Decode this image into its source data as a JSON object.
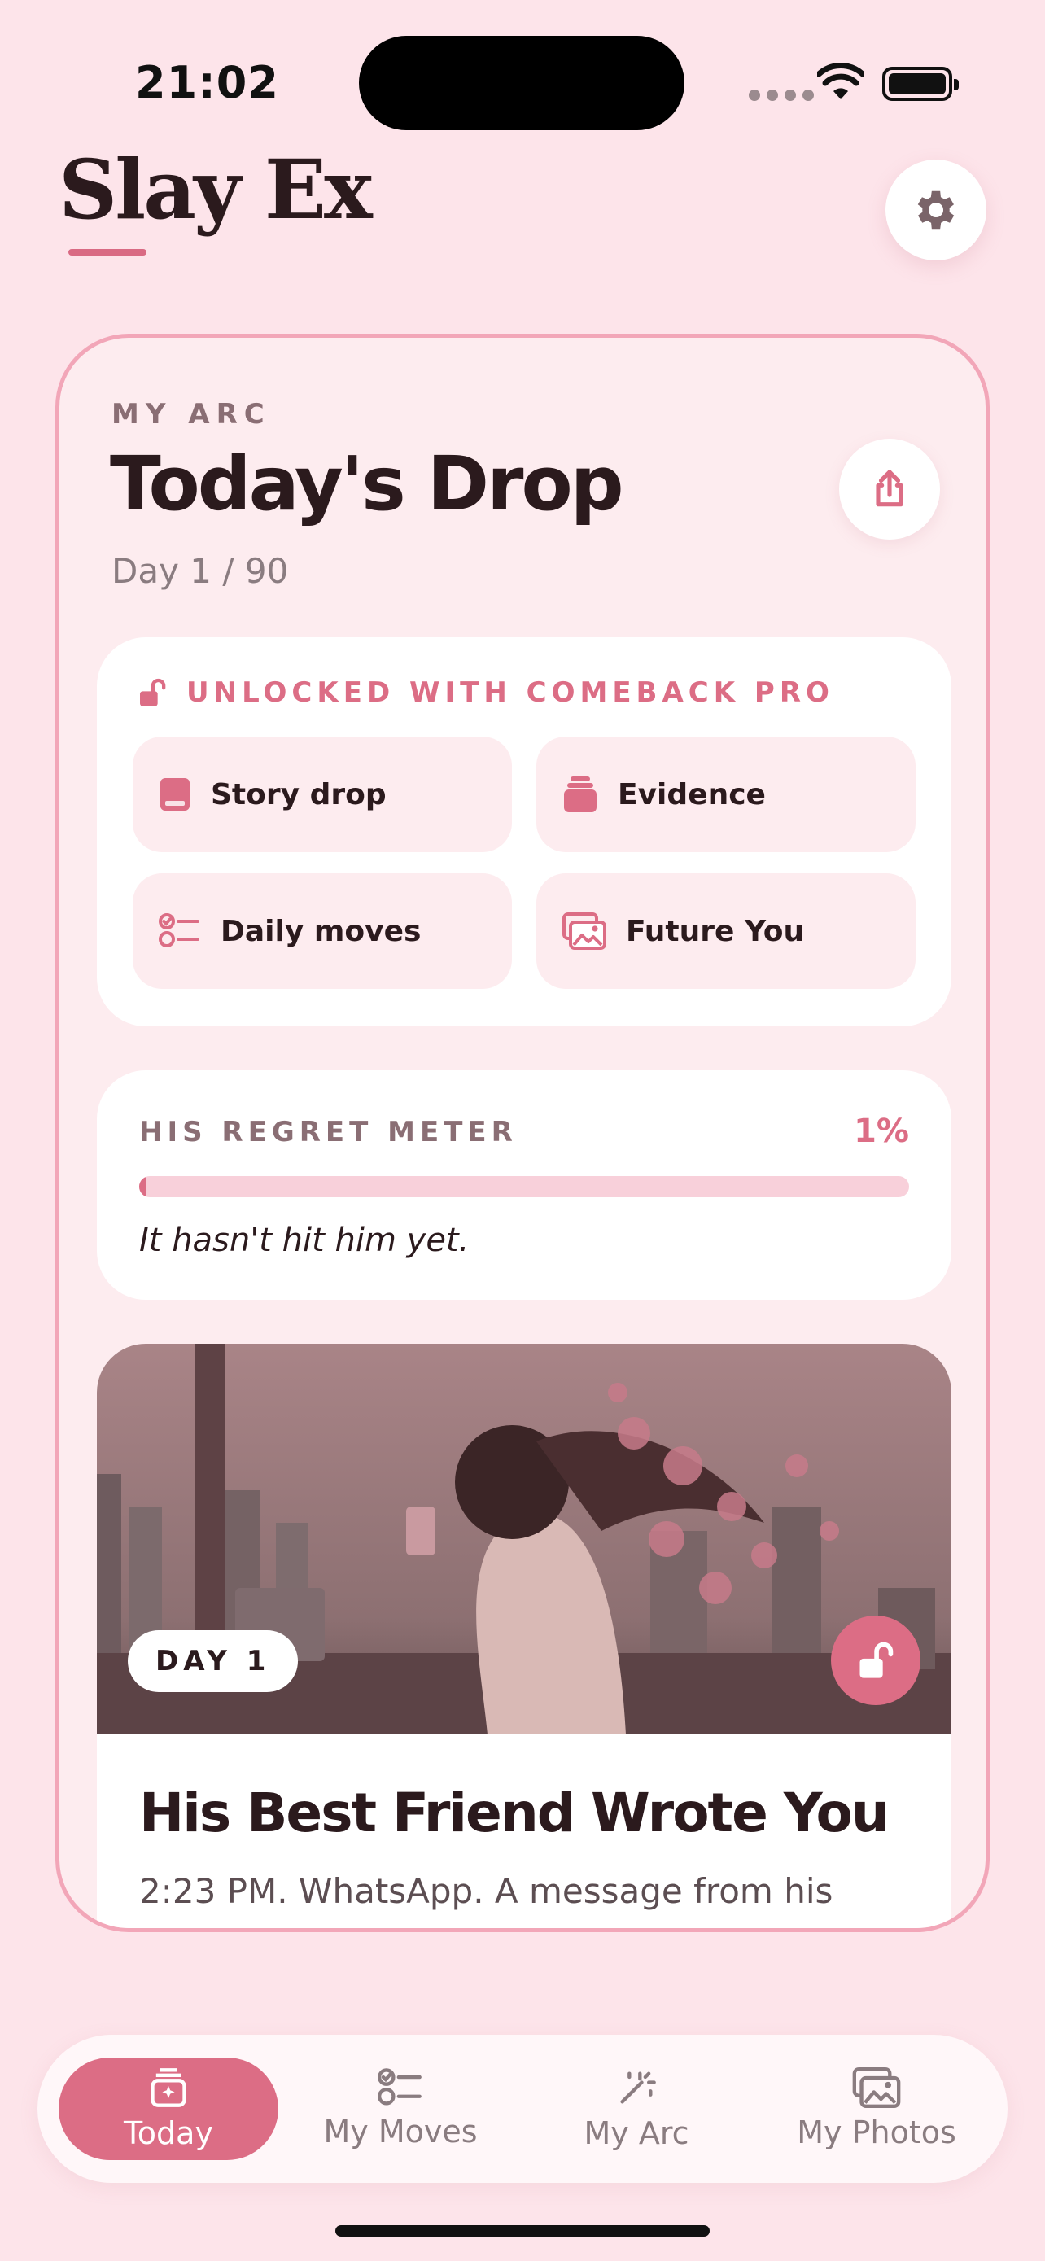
{
  "status_bar": {
    "time": "21:02"
  },
  "header": {
    "app_title": "Slay Ex"
  },
  "arc": {
    "eyebrow": "MY ARC",
    "heading": "Today's Drop",
    "day_counter": "Day 1 / 90"
  },
  "unlocked": {
    "label": "UNLOCKED WITH COMEBACK PRO",
    "features": [
      {
        "label": "Story drop",
        "icon": "book-icon"
      },
      {
        "label": "Evidence",
        "icon": "stack-icon"
      },
      {
        "label": "Daily moves",
        "icon": "checklist-icon"
      },
      {
        "label": "Future You",
        "icon": "photos-icon"
      }
    ]
  },
  "regret_meter": {
    "title": "HIS REGRET METER",
    "value_text": "1%",
    "value": 0.01,
    "caption": "It hasn't hit him yet."
  },
  "story": {
    "day_badge": "DAY 1",
    "title": "His Best Friend Wrote You",
    "snippet": "2:23 PM. WhatsApp. A message from his"
  },
  "tabs": [
    {
      "label": "Today",
      "icon": "today-icon",
      "active": true
    },
    {
      "label": "My Moves",
      "icon": "checklist-icon",
      "active": false
    },
    {
      "label": "My Arc",
      "icon": "magic-wand-icon",
      "active": false
    },
    {
      "label": "My Photos",
      "icon": "photos-icon",
      "active": false
    }
  ],
  "colors": {
    "background": "#fde4ea",
    "accent": "#dc6d85",
    "card": "#ffffff",
    "text": "#2b1a1d"
  }
}
